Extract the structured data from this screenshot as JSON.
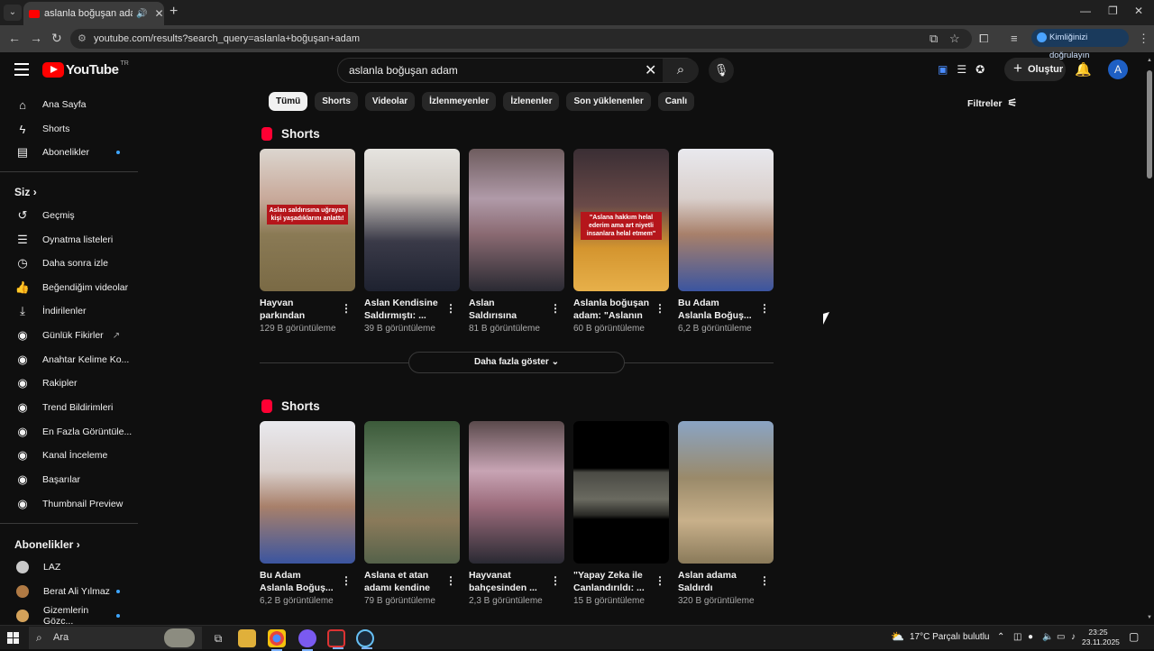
{
  "browser": {
    "tab_title": "aslanla boğuşan adam - YouTube",
    "url": "youtube.com/results?search_query=aslanla+boğuşan+adam",
    "verify_label": "Kimliğinizi doğrulayın"
  },
  "header": {
    "logo_text": "YouTube",
    "logo_region": "TR",
    "search_query": "aslanla boğuşan adam",
    "create_label": "Oluştur",
    "avatar_letter": "A"
  },
  "sidebar": {
    "main": [
      {
        "icon": "home-icon",
        "label": "Ana Sayfa"
      },
      {
        "icon": "shorts-icon",
        "label": "Shorts"
      },
      {
        "icon": "subscriptions-icon",
        "label": "Abonelikler"
      }
    ],
    "you_heading": "Siz",
    "you_items": [
      {
        "icon": "history-icon",
        "label": "Geçmiş"
      },
      {
        "icon": "playlists-icon",
        "label": "Oynatma listeleri"
      },
      {
        "icon": "watch-later-icon",
        "label": "Daha sonra izle"
      },
      {
        "icon": "like-icon",
        "label": "Beğendiğim videolar"
      },
      {
        "icon": "download-icon",
        "label": "İndirilenler"
      },
      {
        "icon": "extension-icon",
        "label": "Günlük Fikirler"
      },
      {
        "icon": "extension-icon",
        "label": "Anahtar Kelime Ko..."
      },
      {
        "icon": "extension-icon",
        "label": "Rakipler"
      },
      {
        "icon": "extension-icon",
        "label": "Trend Bildirimleri"
      },
      {
        "icon": "extension-icon",
        "label": "En Fazla Görüntüle..."
      },
      {
        "icon": "extension-icon",
        "label": "Kanal İnceleme"
      },
      {
        "icon": "extension-icon",
        "label": "Başarılar"
      },
      {
        "icon": "extension-icon",
        "label": "Thumbnail Preview"
      }
    ],
    "subs_heading": "Abonelikler",
    "subscriptions": [
      {
        "label": "LAZ",
        "color": "#c9c9c9"
      },
      {
        "label": "Berat Ali Yılmaz",
        "color": "#b07a44"
      },
      {
        "label": "Gizemlerin Gözc...",
        "color": "#d4a25a"
      }
    ]
  },
  "chips": [
    "Tümü",
    "Shorts",
    "Videolar",
    "İzlenmeyenler",
    "İzlenenler",
    "Son yüklenenler",
    "Canlı"
  ],
  "filters_label": "Filtreler",
  "shelves": [
    {
      "title": "Shorts",
      "items": [
        {
          "title": "Hayvan parkından kaça...",
          "views": "129 B görüntüleme",
          "overlay": "Aslan saldırısına uğrayan kişi yaşadıklarını anlattı!"
        },
        {
          "title": "Aslan Kendisine Saldırmıştı: ...",
          "views": "39 B görüntüleme",
          "overlay": ""
        },
        {
          "title": "Aslan Saldırısına Uğrayan ...",
          "views": "81 B görüntüleme",
          "overlay": ""
        },
        {
          "title": "Aslanla boğuşan adam: \"Aslanın ...",
          "views": "60 B görüntüleme",
          "overlay": "\"Aslana hakkım helal ederim ama art niyetli insanlara helal etmem\""
        },
        {
          "title": "Bu Adam Aslanla Boğuş...",
          "views": "6,2 B görüntüleme",
          "overlay": ""
        }
      ]
    },
    {
      "title": "Shorts",
      "items": [
        {
          "title": "Bu Adam Aslanla Boğuş...",
          "views": "6,2 B görüntüleme",
          "overlay": ""
        },
        {
          "title": "Aslana et atan adamı kendine ...",
          "views": "79 B görüntüleme",
          "overlay": ""
        },
        {
          "title": "Hayvanat bahçesinden ...",
          "views": "2,3 B görüntüleme",
          "overlay": ""
        },
        {
          "title": "\"Yapay Zeka ile Canlandırıldı: ...",
          "views": "15 B görüntüleme",
          "overlay": ""
        },
        {
          "title": "Aslan adama Saldırdı",
          "views": "320 B görüntüleme",
          "overlay": ""
        }
      ]
    }
  ],
  "more_label": "Daha fazla göster",
  "taskbar": {
    "search_placeholder": "Ara",
    "weather": "17°C  Parçalı bulutlu",
    "time": "23:25",
    "date": "23.11.2025"
  }
}
